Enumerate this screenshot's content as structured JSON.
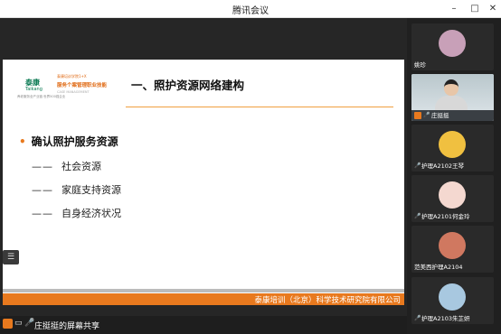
{
  "window": {
    "title": "腾讯会议",
    "buttons": {
      "minimize": "–",
      "maximize": "□",
      "close": "✕"
    }
  },
  "slide": {
    "logo": {
      "brand_cn": "泰康",
      "brand_en": "Taikang",
      "brand_sub": "养老服务全产业链 世界500强企业",
      "partner_line1": "泰康培训学院1+X",
      "partner_line2": "服务个案管理职业技能",
      "partner_line3": "CASE MANAGEMENT"
    },
    "heading": "一、照护资源网络建构",
    "bullet": "确认照护服务资源",
    "sub_items": [
      {
        "dash": "——",
        "text": "社会资源"
      },
      {
        "dash": "——",
        "text": "家庭支持资源"
      },
      {
        "dash": "——",
        "text": "自身经济状况"
      }
    ],
    "footer": "泰康培训（北京）科学技术研究院有限公司"
  },
  "bottombar": {
    "share_label": "庄挺挺的屏幕共享"
  },
  "participants": [
    {
      "name": "姚珍",
      "avatar_color": "#c8a0b8",
      "video": false,
      "muted": false
    },
    {
      "name": "庄挺挺",
      "video": true,
      "muted": true
    },
    {
      "name": "护理A2102王琴",
      "avatar_color": "#f0c040",
      "video": false,
      "muted": false
    },
    {
      "name": "护理A2101何金玲",
      "avatar_color": "#f4d8d0",
      "video": false,
      "muted": false
    },
    {
      "name": "范美西护理A2104",
      "avatar_color": "#d07860",
      "video": false,
      "muted": false
    },
    {
      "name": "护理A2103朱芷妍",
      "avatar_color": "#a8c8e0",
      "video": false,
      "muted": false
    }
  ],
  "colors": {
    "accent": "#e8791e",
    "brand_green": "#0a7a53"
  }
}
